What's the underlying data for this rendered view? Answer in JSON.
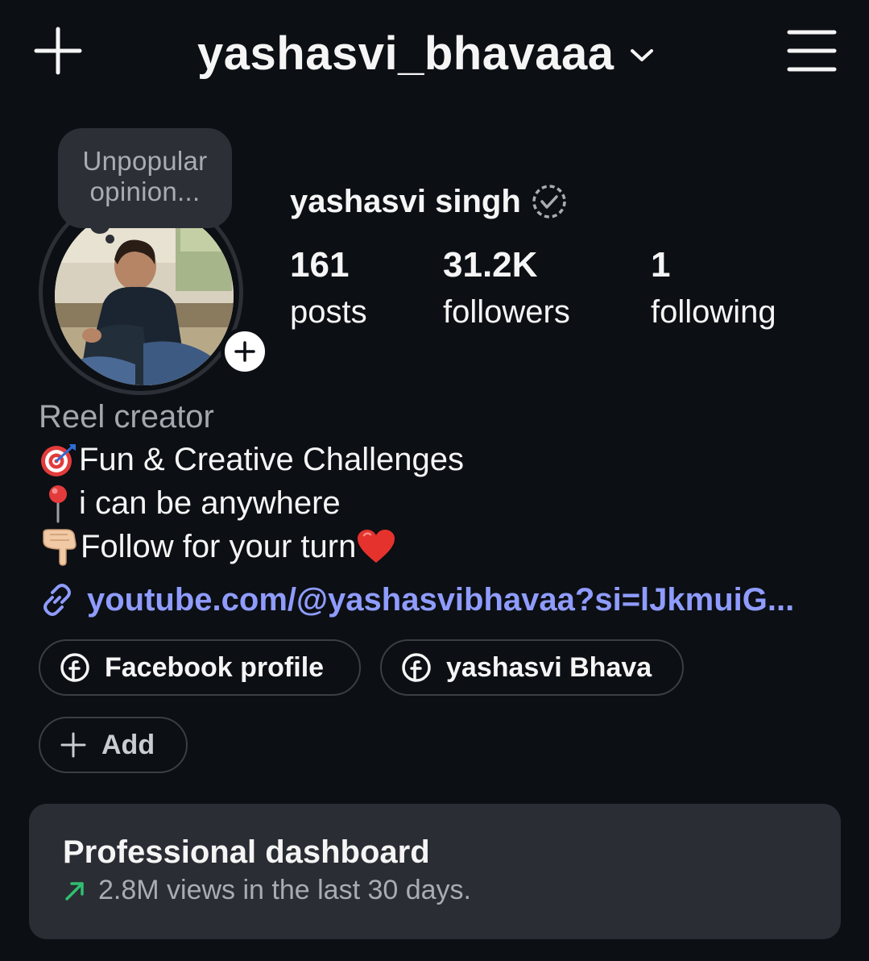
{
  "header": {
    "username": "yashasvi_bhavaaa",
    "new_icon": "plus-icon",
    "switch_icon": "chevron-down-icon",
    "menu_icon": "hamburger-menu-icon"
  },
  "profile": {
    "note": "Unpopular opinion...",
    "display_name": "yashasvi singh",
    "verified_icon": "verified-badge-icon",
    "stats": [
      {
        "value": "161",
        "label": "posts"
      },
      {
        "value": "31.2K",
        "label": "followers"
      },
      {
        "value": "1",
        "label": "following"
      }
    ]
  },
  "bio": {
    "category": "Reel creator",
    "lines": [
      {
        "emoji": "dart-target-icon",
        "text": " Fun & Creative Challenges"
      },
      {
        "emoji": "round-pushpin-icon",
        "text": "i can be anywhere"
      },
      {
        "emoji": "pointing-down-hand-icon",
        "text": "Follow for your turn ",
        "trailing_emoji": "red-heart-icon"
      }
    ],
    "link": "youtube.com/@yashasvibhavaa?si=lJkmuiG..."
  },
  "chips": {
    "facebook_profile": "Facebook profile",
    "facebook_page": "yashasvi Bhava",
    "add": "Add"
  },
  "dashboard": {
    "title": "Professional dashboard",
    "subtitle": "2.8M views in the last 30 days."
  },
  "colors": {
    "background": "#0c0f14",
    "link": "#8f9cff",
    "card": "#2a2d33",
    "trend_up": "#2fbf71"
  }
}
